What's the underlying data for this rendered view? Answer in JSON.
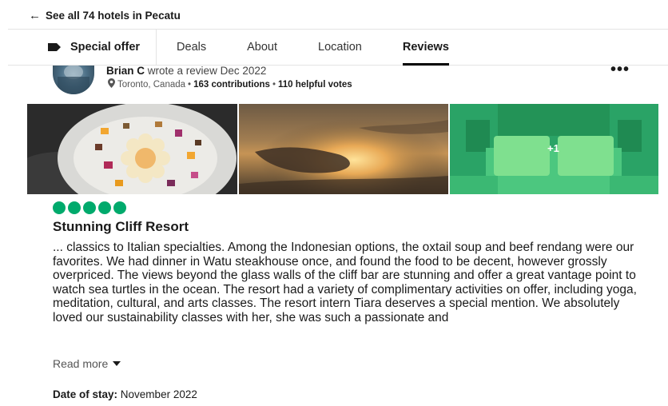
{
  "nav": {
    "back_arrow": "←",
    "back_label": "See all 74 hotels in Pecatu"
  },
  "tabs": {
    "special_offer": "Special offer",
    "deals": "Deals",
    "about": "About",
    "location": "Location",
    "reviews": "Reviews",
    "active": "Reviews"
  },
  "review": {
    "reviewer_name": "Brian C",
    "wrote_text": "wrote a review Dec 2022",
    "location": "Toronto, Canada",
    "separator": "•",
    "contributions": "163 contributions",
    "helpful_votes": "110 helpful votes",
    "more_menu": "•••",
    "photos_extra": "+1",
    "rating": 5,
    "rating_color": "#00aa6c",
    "title": "Stunning Cliff Resort",
    "text": "... classics to Italian specialties. Among the Indonesian options, the oxtail soup and beef rendang were our favorites. We had dinner in Watu steakhouse once, and found the food to be decent, however grossly overpriced. The views beyond the glass walls of the cliff bar are stunning and offer a great vantage point to watch sea turtles in the ocean. The resort had a variety of complimentary activities on offer, including yoga, meditation, cultural, and arts classes. The resort intern Tiara deserves a special mention. We absolutely loved our sustainability classes with her, she was such a passionate and",
    "read_more": "Read more",
    "stay_label": "Date of stay:",
    "stay_value": "November 2022"
  }
}
